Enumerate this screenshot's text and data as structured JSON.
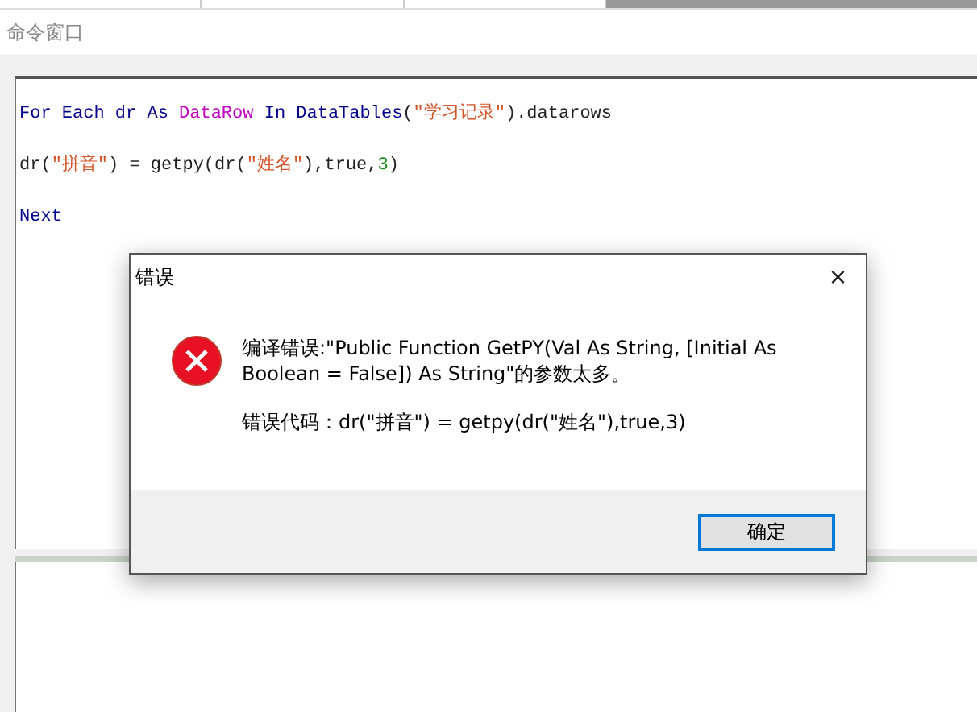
{
  "panel_title": "命令窗口",
  "code_lines": [
    [
      {
        "kind": "keyword",
        "text": "For Each dr As "
      },
      {
        "kind": "type",
        "text": "DataRow"
      },
      {
        "kind": "keyword",
        "text": " In DataTables"
      },
      {
        "kind": "plain",
        "text": "("
      },
      {
        "kind": "string",
        "text": "\"学习记录\""
      },
      {
        "kind": "plain",
        "text": ").datarows"
      }
    ],
    [
      {
        "kind": "plain",
        "text": "dr("
      },
      {
        "kind": "string",
        "text": "\"拼音\""
      },
      {
        "kind": "plain",
        "text": ") = getpy(dr("
      },
      {
        "kind": "string",
        "text": "\"姓名\""
      },
      {
        "kind": "plain",
        "text": "),true,"
      },
      {
        "kind": "number",
        "text": "3"
      },
      {
        "kind": "plain",
        "text": ")"
      }
    ],
    [
      {
        "kind": "keyword",
        "text": "Next"
      }
    ]
  ],
  "dialog": {
    "title": "错误",
    "close": "×",
    "message": "编译错误:\"Public Function GetPY(Val As String, [Initial As Boolean = False]) As String\"的参数太多。",
    "detail": "错误代码：dr(\"拼音\") = getpy(dr(\"姓名\"),true,3)",
    "button": "确定"
  }
}
